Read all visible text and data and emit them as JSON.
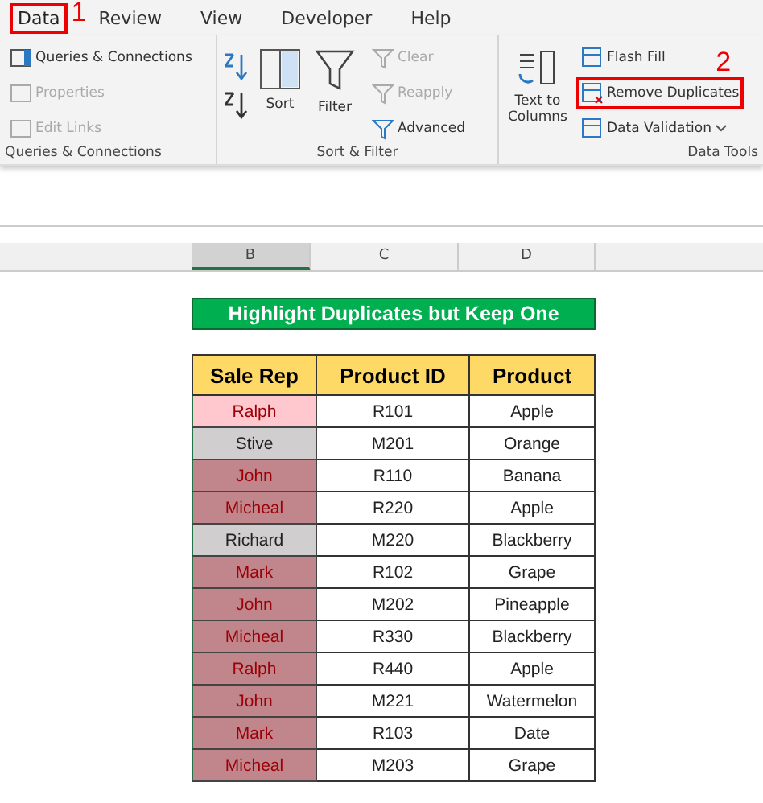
{
  "tabs": [
    {
      "label": "Data",
      "selected": true,
      "callout": "1"
    },
    {
      "label": "Review",
      "selected": false
    },
    {
      "label": "View",
      "selected": false
    },
    {
      "label": "Developer",
      "selected": false
    },
    {
      "label": "Help",
      "selected": false
    }
  ],
  "groups": {
    "queries": {
      "label": "Queries & Connections",
      "items": [
        {
          "label": "Queries & Connections",
          "disabled": false
        },
        {
          "label": "Properties",
          "disabled": true
        },
        {
          "label": "Edit Links",
          "disabled": true
        }
      ]
    },
    "sort_filter": {
      "label": "Sort & Filter",
      "sort": "Sort",
      "filter": "Filter",
      "items": [
        {
          "label": "Clear",
          "disabled": true
        },
        {
          "label": "Reapply",
          "disabled": true
        },
        {
          "label": "Advanced",
          "disabled": false
        }
      ]
    },
    "data_tools": {
      "label": "Data Tools",
      "text_to_columns": "Text to Columns",
      "items": [
        {
          "label": "Flash Fill",
          "highlighted": false
        },
        {
          "label": "Remove Duplicates",
          "highlighted": true,
          "callout": "2"
        },
        {
          "label": "Data Validation",
          "highlighted": false,
          "dropdown": true
        }
      ]
    }
  },
  "columns": [
    {
      "label": "B",
      "selected": true
    },
    {
      "label": "C",
      "selected": false
    },
    {
      "label": "D",
      "selected": false
    }
  ],
  "title": "Highlight Duplicates but Keep One",
  "table": {
    "headers": [
      "Sale Rep",
      "Product ID",
      "Product"
    ],
    "rows": [
      {
        "rep": "Ralph",
        "color": "#ffc7ce",
        "id": "R101",
        "product": "Apple"
      },
      {
        "rep": "Stive",
        "color": "#d0cece",
        "id": "M201",
        "product": "Orange"
      },
      {
        "rep": "John",
        "color": "#c0868c",
        "id": "R110",
        "product": "Banana"
      },
      {
        "rep": "Micheal",
        "color": "#c0868c",
        "id": "R220",
        "product": "Apple"
      },
      {
        "rep": "Richard",
        "color": "#d0cece",
        "id": "M220",
        "product": "Blackberry"
      },
      {
        "rep": "Mark",
        "color": "#c0868c",
        "id": "R102",
        "product": "Grape"
      },
      {
        "rep": "John",
        "color": "#c0868c",
        "id": "M202",
        "product": "Pineapple"
      },
      {
        "rep": "Micheal",
        "color": "#c0868c",
        "id": "R330",
        "product": "Blackberry"
      },
      {
        "rep": "Ralph",
        "color": "#c0868c",
        "id": "R440",
        "product": "Apple"
      },
      {
        "rep": "John",
        "color": "#c0868c",
        "id": "M221",
        "product": "Watermelon"
      },
      {
        "rep": "Mark",
        "color": "#c0868c",
        "id": "R103",
        "product": "Date"
      },
      {
        "rep": "Micheal",
        "color": "#c0868c",
        "id": "M203",
        "product": "Grape"
      }
    ]
  }
}
